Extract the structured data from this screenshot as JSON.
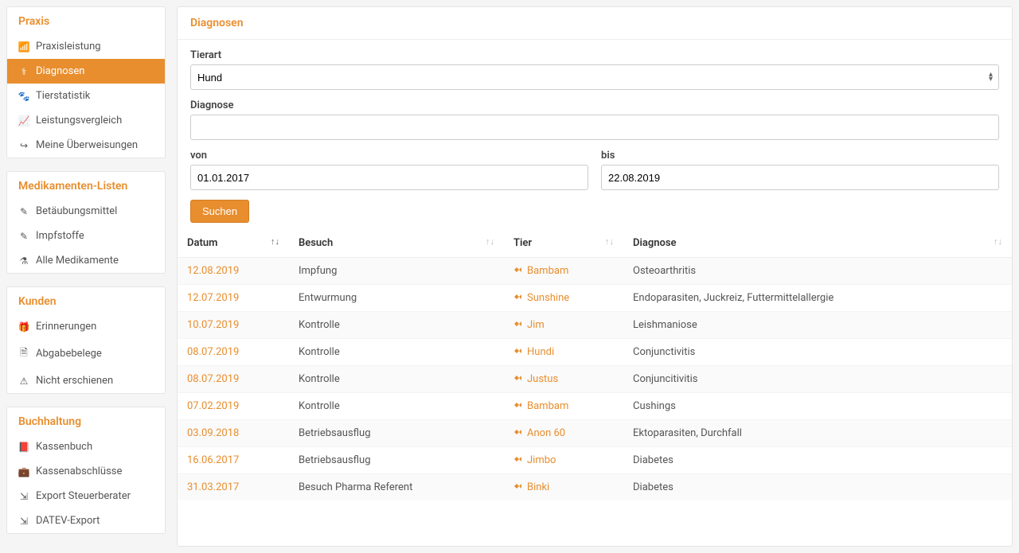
{
  "sidebar": {
    "groups": [
      {
        "title": "Praxis",
        "items": [
          {
            "icon": "bars-icon",
            "label": "Praxisleistung"
          },
          {
            "icon": "stethoscope-icon",
            "label": "Diagnosen",
            "active": true
          },
          {
            "icon": "paw-icon",
            "label": "Tierstatistik"
          },
          {
            "icon": "chart-line-icon",
            "label": "Leistungsvergleich"
          },
          {
            "icon": "transfer-icon",
            "label": "Meine Überweisungen"
          }
        ]
      },
      {
        "title": "Medikamenten-Listen",
        "items": [
          {
            "icon": "syringe-icon",
            "label": "Betäubungsmittel"
          },
          {
            "icon": "syringe-icon",
            "label": "Impfstoffe"
          },
          {
            "icon": "pills-icon",
            "label": "Alle Medikamente"
          }
        ]
      },
      {
        "title": "Kunden",
        "items": [
          {
            "icon": "gift-icon",
            "label": "Erinnerungen"
          },
          {
            "icon": "receipt-icon",
            "label": "Abgabebelege"
          },
          {
            "icon": "warning-icon",
            "label": "Nicht erschienen"
          }
        ]
      },
      {
        "title": "Buchhaltung",
        "items": [
          {
            "icon": "book-icon",
            "label": "Kassenbuch"
          },
          {
            "icon": "briefcase-icon",
            "label": "Kassenabschlüsse"
          },
          {
            "icon": "export-icon",
            "label": "Export Steuerberater"
          },
          {
            "icon": "export-icon",
            "label": "DATEV-Export"
          }
        ]
      }
    ]
  },
  "panel": {
    "title": "Diagnosen",
    "form": {
      "tierart_label": "Tierart",
      "tierart_value": "Hund",
      "diagnose_label": "Diagnose",
      "diagnose_value": "",
      "von_label": "von",
      "von_value": "01.01.2017",
      "bis_label": "bis",
      "bis_value": "22.08.2019",
      "search_btn": "Suchen"
    },
    "table": {
      "headers": [
        "Datum",
        "Besuch",
        "Tier",
        "Diagnose"
      ],
      "rows": [
        {
          "datum": "12.08.2019",
          "besuch": "Impfung",
          "tier": "Bambam",
          "diagnose": "Osteoarthritis"
        },
        {
          "datum": "12.07.2019",
          "besuch": "Entwurmung",
          "tier": "Sunshine",
          "diagnose": "Endoparasiten, Juckreiz, Futtermittelallergie"
        },
        {
          "datum": "10.07.2019",
          "besuch": "Kontrolle",
          "tier": "Jim",
          "diagnose": "Leishmaniose"
        },
        {
          "datum": "08.07.2019",
          "besuch": "Kontrolle",
          "tier": "Hundi",
          "diagnose": "Conjunctivitis"
        },
        {
          "datum": "08.07.2019",
          "besuch": "Kontrolle",
          "tier": "Justus",
          "diagnose": "Conjuncitivitis"
        },
        {
          "datum": "07.02.2019",
          "besuch": "Kontrolle",
          "tier": "Bambam",
          "diagnose": "Cushings"
        },
        {
          "datum": "03.09.2018",
          "besuch": "Betriebsausflug",
          "tier": "Anon 60",
          "diagnose": "Ektoparasiten, Durchfall"
        },
        {
          "datum": "16.06.2017",
          "besuch": "Betriebsausflug",
          "tier": "Jimbo",
          "diagnose": "Diabetes"
        },
        {
          "datum": "31.03.2017",
          "besuch": "Besuch Pharma Referent",
          "tier": "Binki",
          "diagnose": "Diabetes"
        }
      ]
    }
  },
  "icons": {
    "bars-icon": "📶",
    "stethoscope-icon": "⚕",
    "paw-icon": "🐾",
    "chart-line-icon": "📈",
    "transfer-icon": "↪",
    "syringe-icon": "✎",
    "pills-icon": "⚗",
    "gift-icon": "🎁",
    "receipt-icon": "🗎",
    "warning-icon": "⚠",
    "book-icon": "📕",
    "briefcase-icon": "💼",
    "export-icon": "⇲",
    "dog-icon": "🐕"
  }
}
